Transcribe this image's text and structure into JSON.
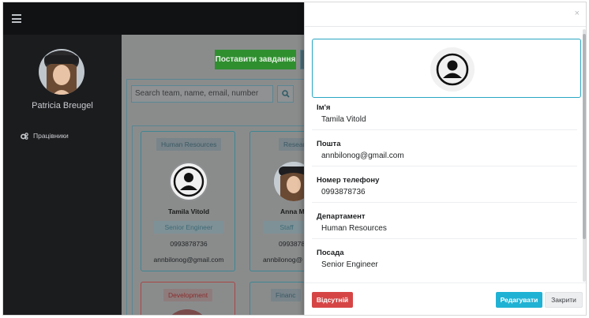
{
  "sidebar": {
    "user_name": "Patricia Breugel",
    "nav_items": [
      {
        "label": "Працівники",
        "icon": "gears-icon"
      }
    ]
  },
  "main": {
    "assign_task_label": "Поставити завдання",
    "search_placeholder": "Search team, name, email, number",
    "cards": [
      {
        "department": "Human Resources",
        "name": "Tamila Vitold",
        "role": "Senior Engineer",
        "phone": "0993878736",
        "email": "annbilonog@gmail.com",
        "has_photo": false
      },
      {
        "department": "Research",
        "name": "Anna M",
        "role": "Staff",
        "phone": "0993878",
        "email": "annbilonog@",
        "has_photo": true
      },
      {
        "department": "Development",
        "name": "",
        "role": "",
        "phone": "",
        "email": "",
        "has_photo": false
      },
      {
        "department": "Financ",
        "name": "",
        "role": "",
        "phone": "",
        "email": "",
        "has_photo": false
      }
    ]
  },
  "modal": {
    "close_symbol": "×",
    "fields": [
      {
        "label": "Ім'я",
        "value": "Tamila Vitold"
      },
      {
        "label": "Пошта",
        "value": "annbilonog@gmail.com"
      },
      {
        "label": "Номер телефону",
        "value": "0993878736"
      },
      {
        "label": "Департамент",
        "value": "Human Resources"
      },
      {
        "label": "Посада",
        "value": "Senior Engineer"
      }
    ],
    "absent_label": "Відсутній",
    "edit_label": "Редагувати",
    "close_label": "Закрити"
  },
  "colors": {
    "accent": "#1fb2d4",
    "danger": "#d64545",
    "success": "#2f8f2f",
    "sidebar": "#1b1c1e"
  }
}
